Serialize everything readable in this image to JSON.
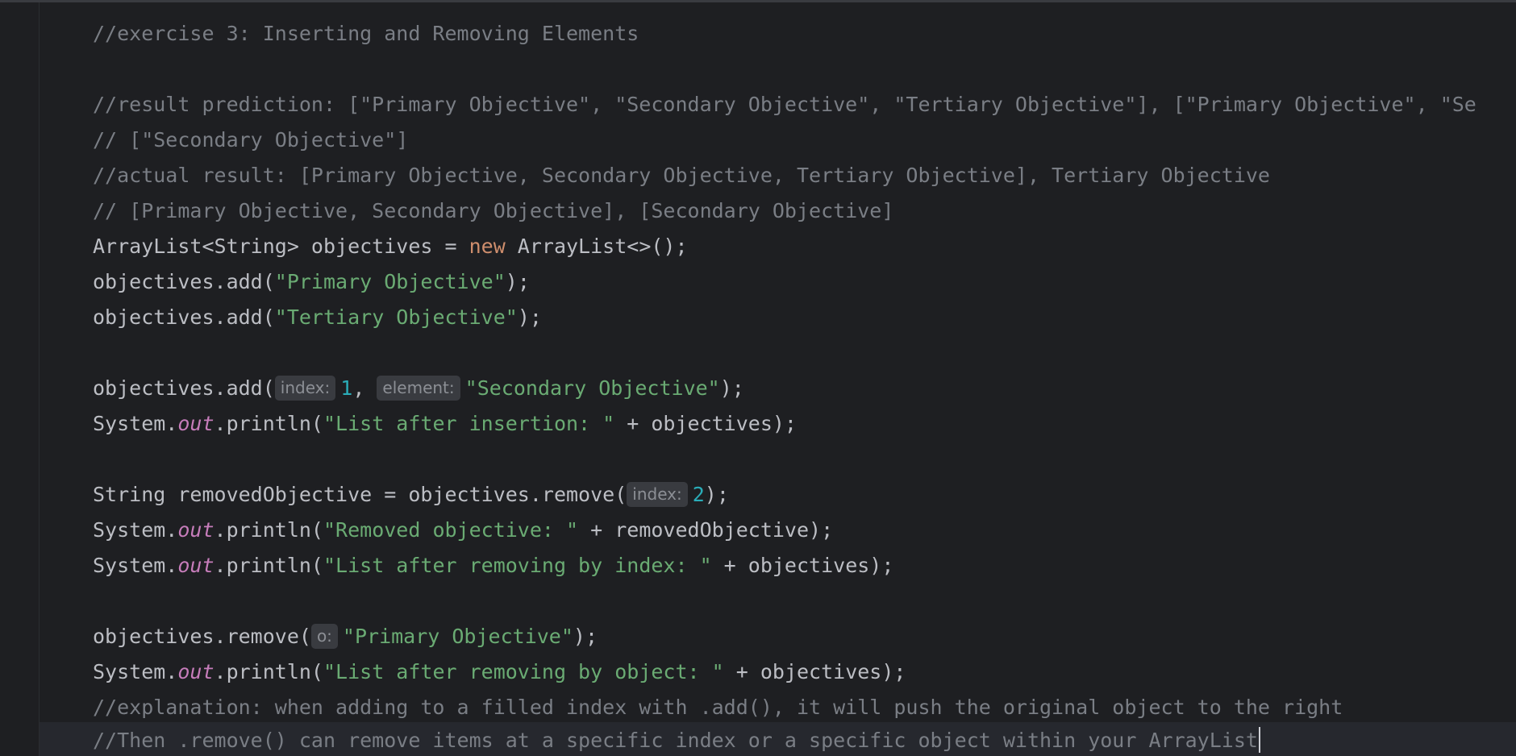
{
  "colors": {
    "background": "#1e1f22",
    "comment": "#7a7e85",
    "keyword": "#cf8e6d",
    "string": "#6aab73",
    "number": "#2aacb8",
    "static_field": "#c77dbb",
    "plain": "#bcbec4",
    "inlay_hint_bg": "#393b40"
  },
  "editor": {
    "lines": [
      "//exercise 3: Inserting and Removing Elements",
      "",
      "//result prediction: [\"Primary Objective\", \"Secondary Objective\", \"Tertiary Objective\"], [\"Primary Objective\", \"Se",
      "// [\"Secondary Objective\"]",
      "//actual result: [Primary Objective, Secondary Objective, Tertiary Objective], Tertiary Objective",
      "// [Primary Objective, Secondary Objective], [Secondary Objective]",
      {
        "l5_a": "ArrayList<String> objectives = ",
        "l5_kw": "new",
        "l5_b": " ArrayList<>();"
      },
      {
        "a": "objectives.add(",
        "s": "\"Primary Objective\"",
        "b": ");"
      },
      {
        "a": "objectives.add(",
        "s": "\"Tertiary Objective\"",
        "b": ");"
      },
      "",
      {
        "a": "objectives.add(",
        "hint1": "index:",
        "n": "1",
        "comma": ", ",
        "hint2": "element:",
        "s": "\"Secondary Objective\"",
        "b": ");"
      },
      {
        "a": "System.",
        "f": "out",
        "b": ".println(",
        "s": "\"List after insertion: \"",
        "c": " + objectives);"
      },
      "",
      {
        "a": "String removedObjective = objectives.remove(",
        "hint": "index:",
        "n": "2",
        "b": ");"
      },
      {
        "a": "System.",
        "f": "out",
        "b": ".println(",
        "s": "\"Removed objective: \"",
        "c": " + removedObjective);"
      },
      {
        "a": "System.",
        "f": "out",
        "b": ".println(",
        "s": "\"List after removing by index: \"",
        "c": " + objectives);"
      },
      "",
      {
        "a": "objectives.remove(",
        "hint": "o:",
        "s": "\"Primary Objective\"",
        "b": ");"
      },
      {
        "a": "System.",
        "f": "out",
        "b": ".println(",
        "s": "\"List after removing by object: \"",
        "c": " + objectives);"
      },
      "//explanation: when adding to a filled index with .add(), it will push the original object to the right",
      "//Then .remove() can remove items at a specific index or a specific object within your ArrayList"
    ]
  }
}
